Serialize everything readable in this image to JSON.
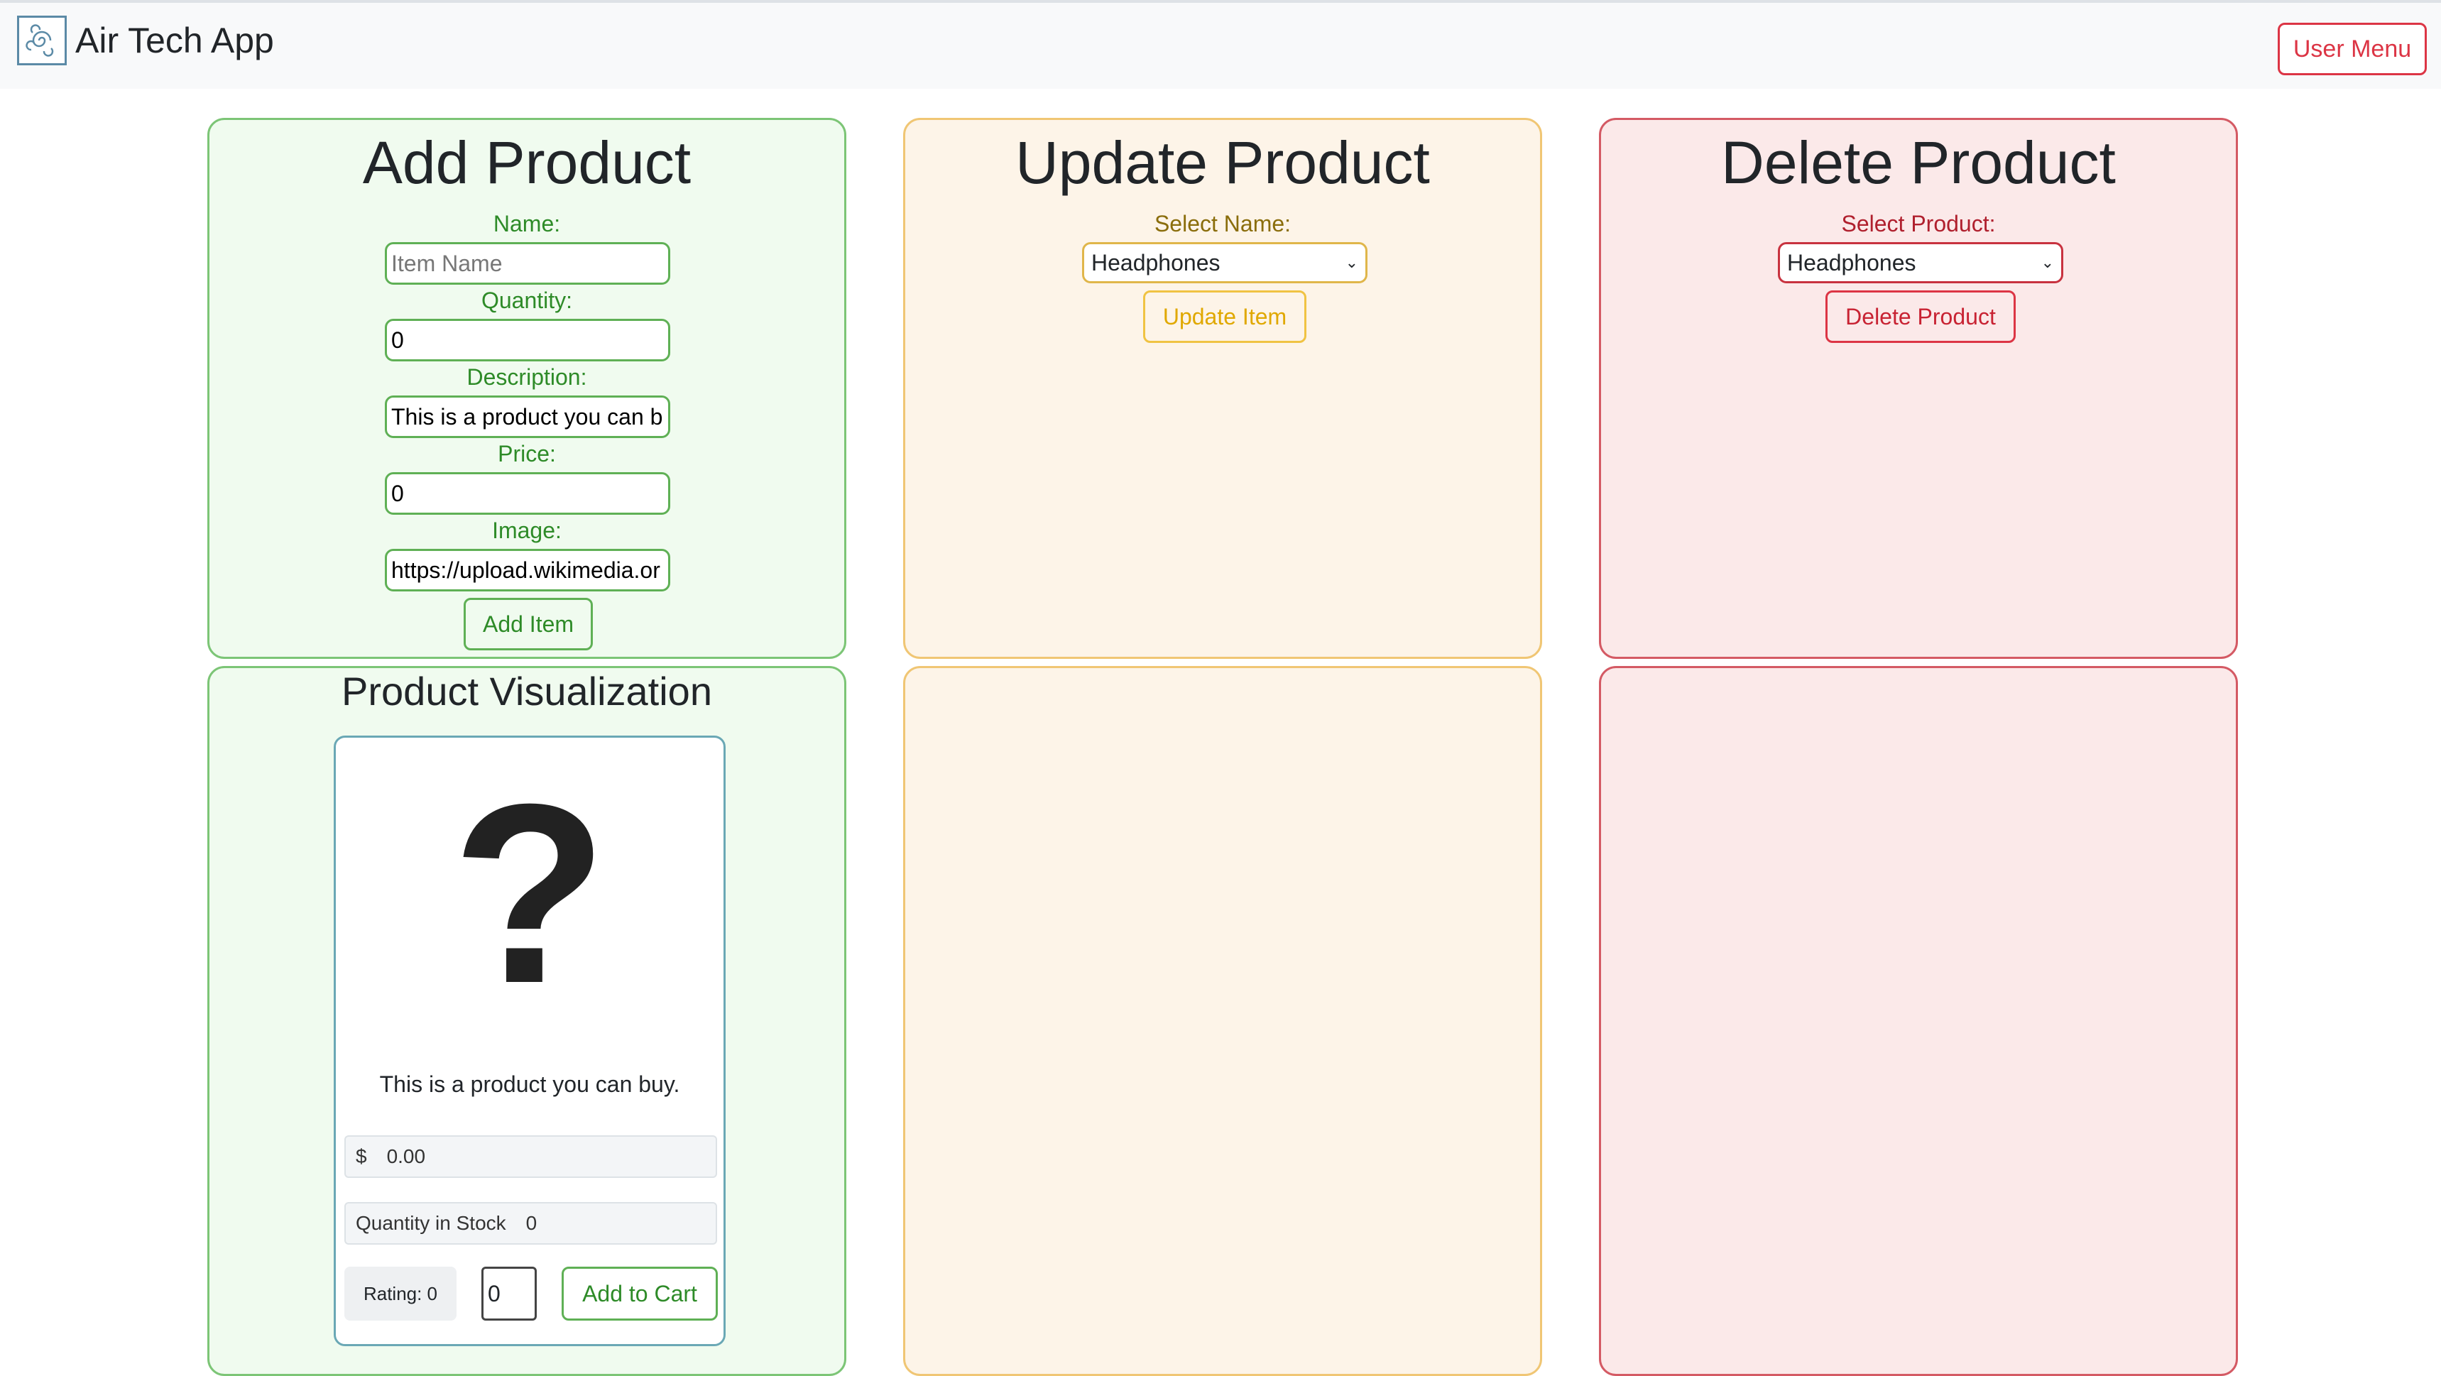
{
  "header": {
    "title": "Air Tech App",
    "user_menu_label": "User Menu"
  },
  "add_panel": {
    "title": "Add Product",
    "name_label": "Name:",
    "name_placeholder": "Item Name",
    "quantity_label": "Quantity:",
    "quantity_value": "0",
    "description_label": "Description:",
    "description_value": "This is a product you can b",
    "price_label": "Price:",
    "price_value": "0",
    "image_label": "Image:",
    "image_value": "https://upload.wikimedia.or",
    "add_button": "Add Item"
  },
  "update_panel": {
    "title": "Update Product",
    "select_label": "Select Name:",
    "selected": "Headphones",
    "button": "Update Item"
  },
  "delete_panel": {
    "title": "Delete Product",
    "select_label": "Select Product:",
    "selected": "Headphones",
    "button": "Delete Product"
  },
  "visualization": {
    "title": "Product Visualization",
    "image_glyph": "?",
    "description": "This is a product you can buy.",
    "price_prefix": "$",
    "price_value": "0.00",
    "stock_label": "Quantity in Stock",
    "stock_value": "0",
    "rating_label": "Rating: 0",
    "cart_qty": "0",
    "add_to_cart": "Add to Cart"
  },
  "colors": {
    "green_accent": "#5fb055",
    "yellow_accent": "#f0c343",
    "red_accent": "#dc3545"
  }
}
